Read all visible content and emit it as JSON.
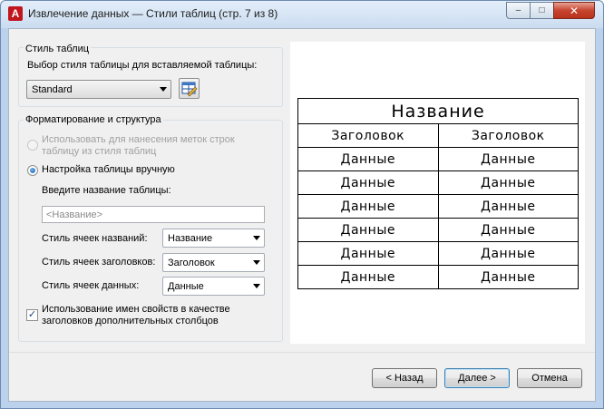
{
  "window": {
    "title": "Извлечение данных — Стили таблиц (стр. 7 из 8)",
    "icon": "autocad-a-icon",
    "controls": {
      "minimize": "–",
      "maximize": "□",
      "close": "✕"
    }
  },
  "table_style_group": {
    "caption": "Стиль таблиц",
    "prompt": "Выбор стиля таблицы для вставляемой таблицы:",
    "selected_style": "Standard"
  },
  "formatting_group": {
    "caption": "Форматирование и структура",
    "option_labels": {
      "use_table_line1": "Использовать для нанесения меток строк",
      "use_table_line2": "таблицу из стиля таблиц",
      "manual": "Настройка таблицы вручную"
    },
    "name_prompt": "Введите название таблицы:",
    "name_placeholder": "<Название>",
    "cell_styles": {
      "title_label": "Стиль ячеек названий:",
      "title_value": "Название",
      "header_label": "Стиль ячеек заголовков:",
      "header_value": "Заголовок",
      "data_label": "Стиль ячеек данных:",
      "data_value": "Данные"
    },
    "checkbox_line1": "Использование имен свойств в качестве",
    "checkbox_line2": "заголовков дополнительных столбцов",
    "checkbox_checked": true
  },
  "preview": {
    "title": "Название",
    "headers": [
      "Заголовок",
      "Заголовок"
    ],
    "rows": [
      [
        "Данные",
        "Данные"
      ],
      [
        "Данные",
        "Данные"
      ],
      [
        "Данные",
        "Данные"
      ],
      [
        "Данные",
        "Данные"
      ],
      [
        "Данные",
        "Данные"
      ],
      [
        "Данные",
        "Данные"
      ]
    ]
  },
  "buttons": {
    "back": "< Назад",
    "next": "Далее >",
    "cancel": "Отмена"
  }
}
